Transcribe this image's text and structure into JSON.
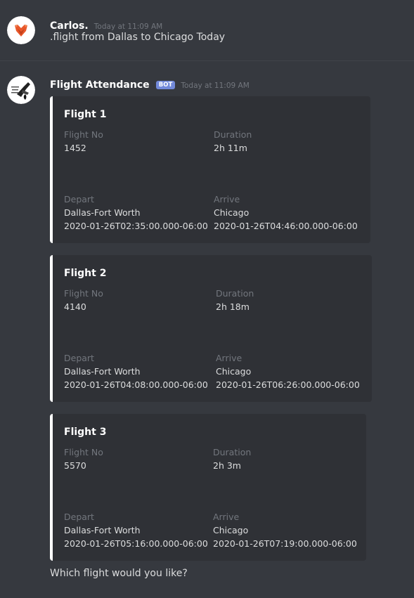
{
  "messages": [
    {
      "username": "Carlos.",
      "timestamp": "Today at 11:09 AM",
      "content": ".flight from Dallas to Chicago Today",
      "avatar_icon": "fox-icon"
    },
    {
      "username": "Flight Attendance",
      "bot_tag": "BOT",
      "timestamp": "Today at 11:09 AM",
      "avatar_icon": "flight-attendance-logo-icon",
      "embeds": [
        {
          "title": "Flight 1",
          "flight_no_label": "Flight No",
          "flight_no": "1452",
          "duration_label": "Duration",
          "duration": "2h 11m",
          "depart_label": "Depart",
          "depart_city": "Dallas-Fort Worth",
          "depart_time": "2020-01-26T02:35:00.000-06:00",
          "arrive_label": "Arrive",
          "arrive_city": "Chicago",
          "arrive_time": "2020-01-26T04:46:00.000-06:00"
        },
        {
          "title": "Flight 2",
          "flight_no_label": "Flight No",
          "flight_no": "4140",
          "duration_label": "Duration",
          "duration": "2h 18m",
          "depart_label": "Depart",
          "depart_city": "Dallas-Fort Worth",
          "depart_time": "2020-01-26T04:08:00.000-06:00",
          "arrive_label": "Arrive",
          "arrive_city": "Chicago",
          "arrive_time": "2020-01-26T06:26:00.000-06:00"
        },
        {
          "title": "Flight 3",
          "flight_no_label": "Flight No",
          "flight_no": "5570",
          "duration_label": "Duration",
          "duration": "2h 3m",
          "depart_label": "Depart",
          "depart_city": "Dallas-Fort Worth",
          "depart_time": "2020-01-26T05:16:00.000-06:00",
          "arrive_label": "Arrive",
          "arrive_city": "Chicago",
          "arrive_time": "2020-01-26T07:19:00.000-06:00"
        }
      ],
      "followup": "Which flight would you like?"
    }
  ],
  "colors": {
    "background": "#36393f",
    "embed_background": "#2f3136",
    "embed_border": "#ffffff",
    "bot_tag": "#7289da",
    "fox": "#e8572a"
  }
}
